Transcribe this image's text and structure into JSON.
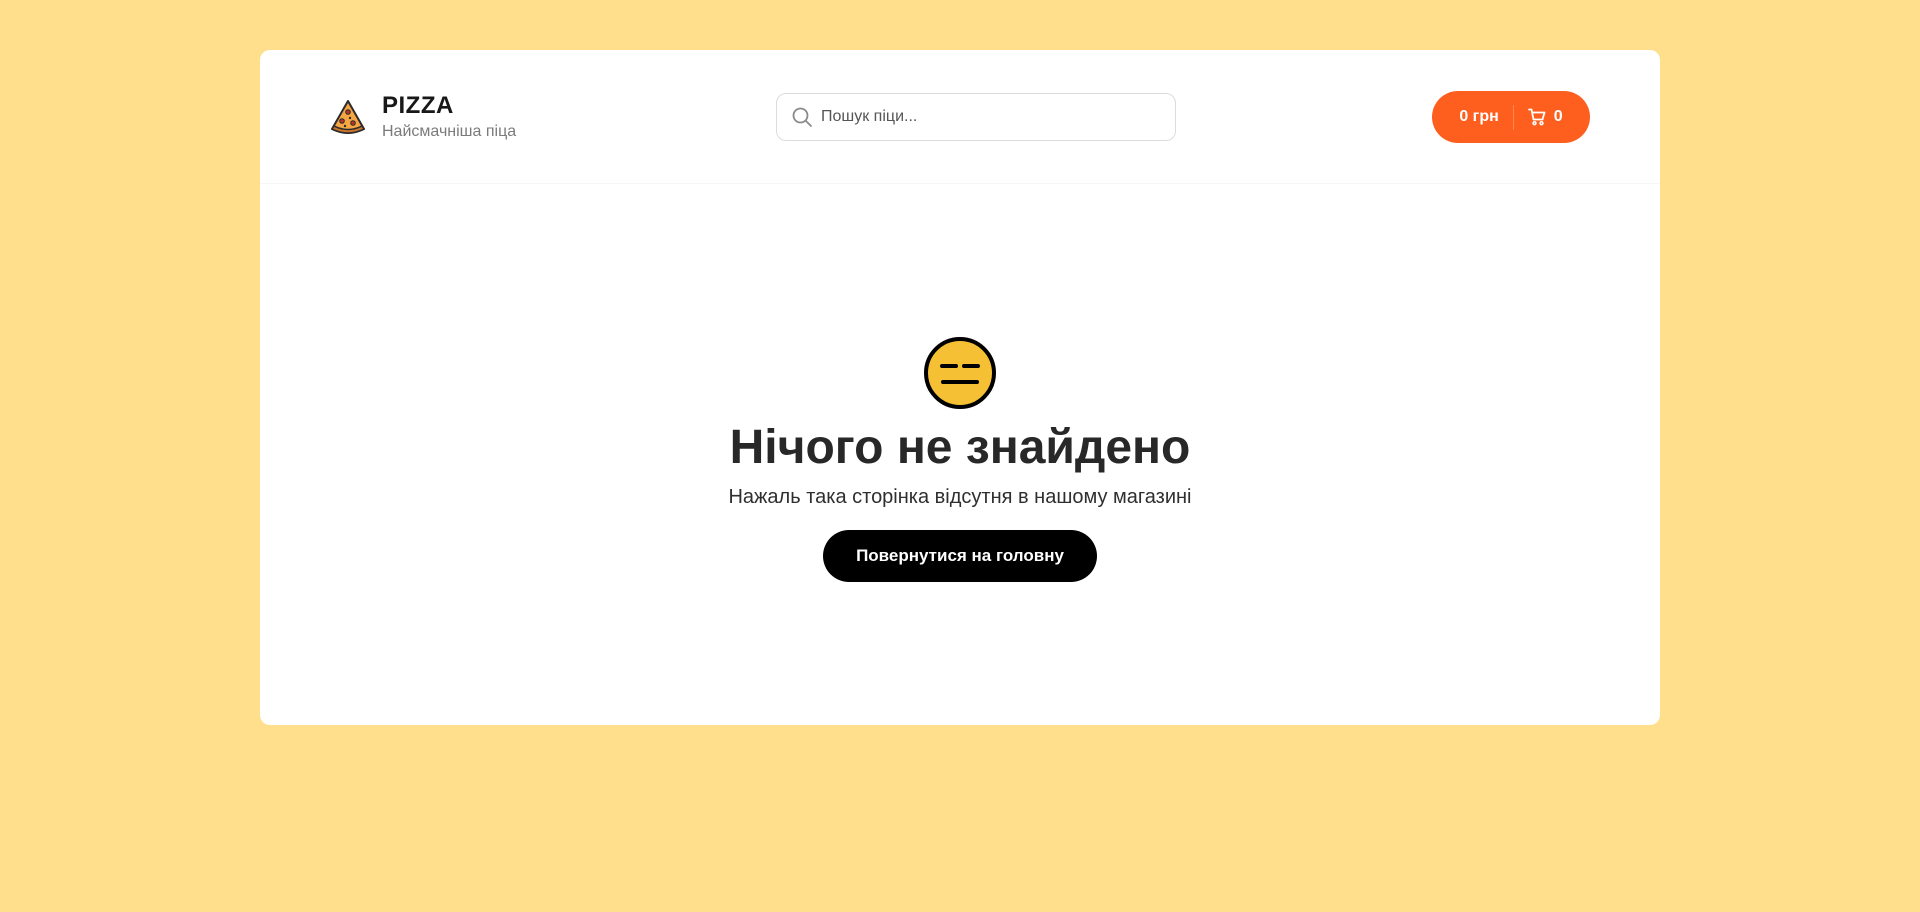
{
  "header": {
    "logo_title": "PIZZA",
    "logo_subtitle": "Найсмачніша піца",
    "search_placeholder": "Пошук піци...",
    "cart": {
      "price": "0 грн",
      "count": "0"
    }
  },
  "not_found": {
    "emoji_icon": "neutral-face-icon",
    "title": "Нічого не знайдено",
    "subtitle": "Нажаль така сторінка відсутня в нашому магазині",
    "button_label": "Повернутися на головну"
  },
  "colors": {
    "page_background": "#ffdf8c",
    "accent": "#fe5f1e",
    "button_dark": "#000000",
    "emoji_yellow": "#f5c033"
  }
}
